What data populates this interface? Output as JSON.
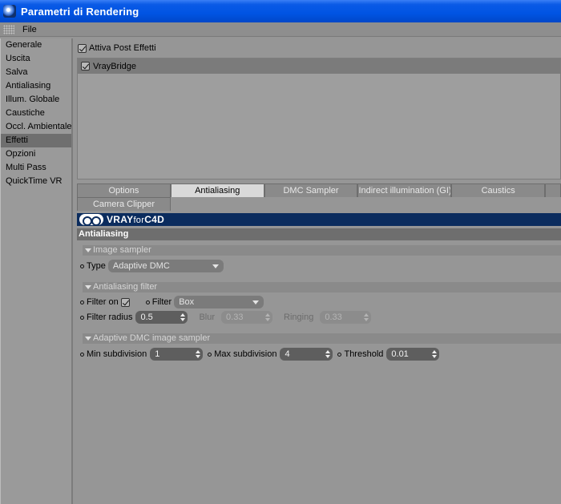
{
  "window": {
    "title": "Parametri di Rendering"
  },
  "menubar": {
    "file": "File"
  },
  "sidebar": {
    "items": [
      {
        "label": "Generale"
      },
      {
        "label": "Uscita"
      },
      {
        "label": "Salva"
      },
      {
        "label": "Antialiasing"
      },
      {
        "label": "Illum. Globale"
      },
      {
        "label": "Caustiche"
      },
      {
        "label": "Occl. Ambientale"
      },
      {
        "label": "Effetti"
      },
      {
        "label": "Opzioni"
      },
      {
        "label": "Multi Pass"
      },
      {
        "label": "QuickTime VR"
      }
    ],
    "active_index": 7
  },
  "post_effects": {
    "label": "Attiva Post Effetti",
    "checked": true
  },
  "effects_list": {
    "items": [
      {
        "label": "VrayBridge",
        "checked": true
      }
    ]
  },
  "tabs": {
    "row1": [
      "Options",
      "Antialiasing",
      "DMC Sampler",
      "Indirect illumination (GI)",
      "Caustics",
      ""
    ],
    "row2": [
      "Camera Clipper"
    ],
    "active": "Antialiasing"
  },
  "banner": {
    "text_bold": "VRAY",
    "text_for": "for",
    "text_c4d": "C4D"
  },
  "section": {
    "title": "Antialiasing"
  },
  "image_sampler": {
    "header": "Image sampler",
    "type_label": "Type",
    "type_value": "Adaptive DMC"
  },
  "aa_filter": {
    "header": "Antialiasing filter",
    "filter_on_label": "Filter on",
    "filter_on_checked": true,
    "filter_label": "Filter",
    "filter_value": "Box",
    "radius_label": "Filter radius",
    "radius_value": "0.5",
    "blur_label": "Blur",
    "blur_value": "0.33",
    "ringing_label": "Ringing",
    "ringing_value": "0.33"
  },
  "adaptive_dmc": {
    "header": "Adaptive DMC image sampler",
    "min_label": "Min subdivision",
    "min_value": "1",
    "max_label": "Max subdivision",
    "max_value": "4",
    "threshold_label": "Threshold",
    "threshold_value": "0.01"
  },
  "colors": {
    "titlebar": "#0054e3",
    "background": "#969696",
    "banner": "#0b2c5e",
    "active_tab": "#d9d9d9"
  }
}
